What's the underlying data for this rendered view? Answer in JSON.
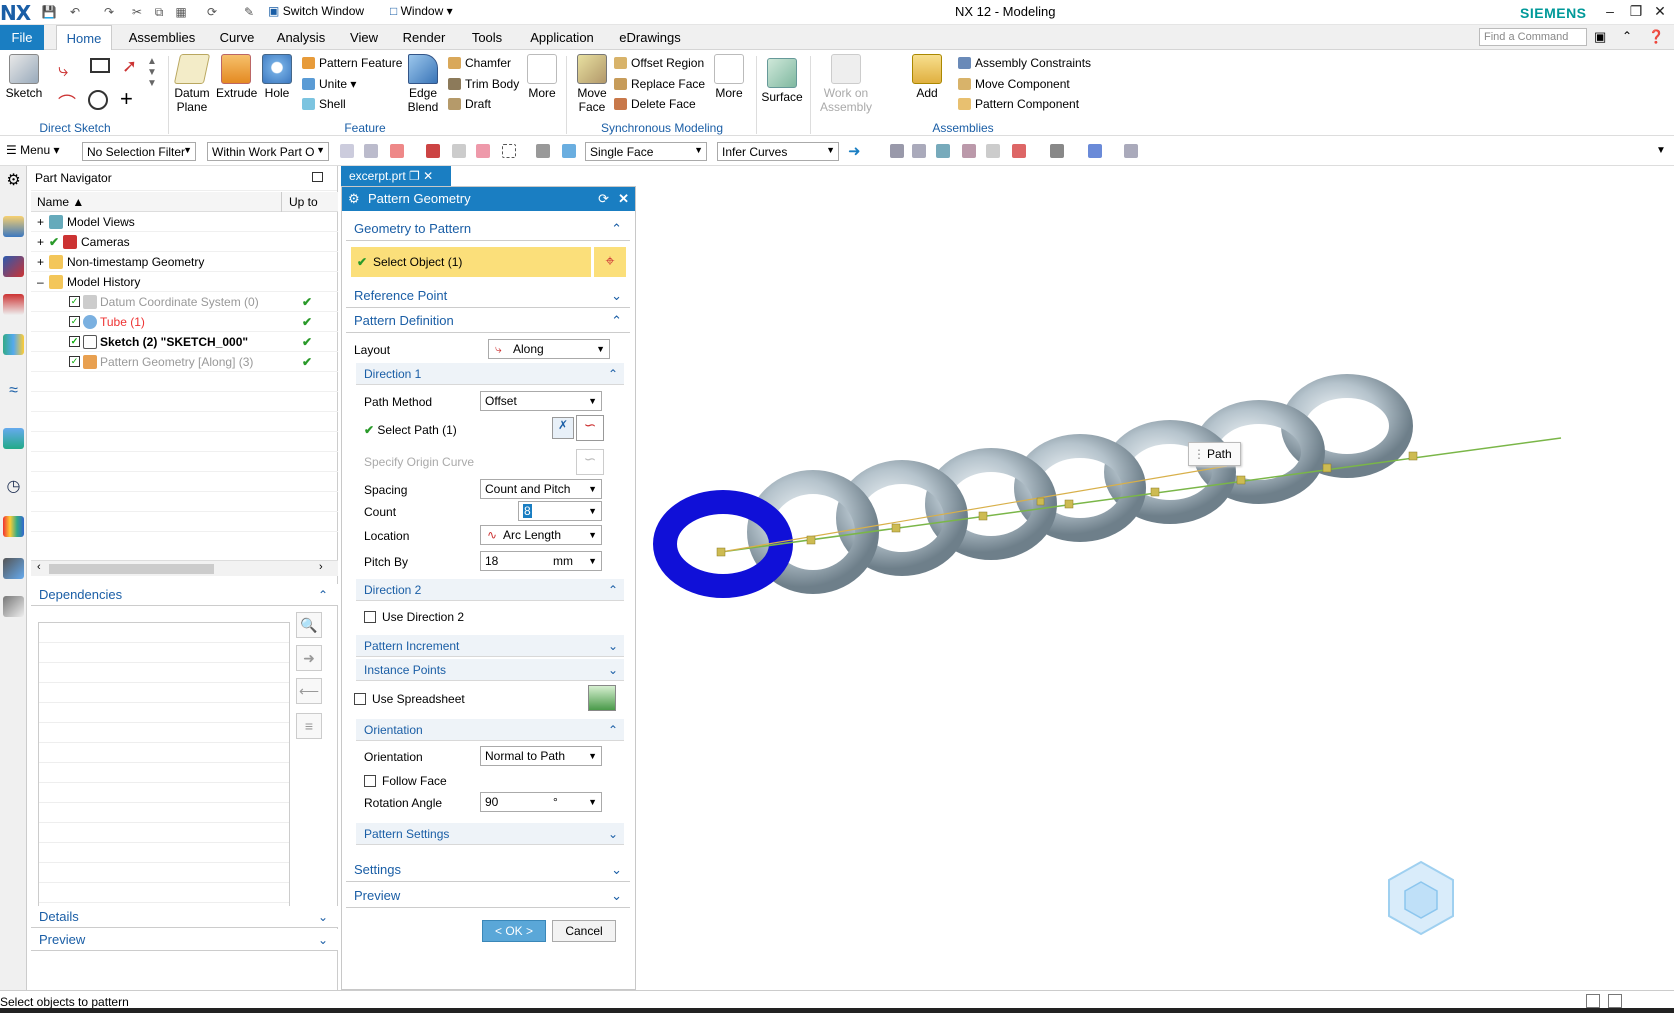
{
  "app": {
    "logo": "NX",
    "title": "NX 12 - Modeling",
    "brand": "SIEMENS",
    "switch_window": "Switch Window",
    "window_menu": "Window"
  },
  "tabs": [
    "File",
    "Home",
    "Assemblies",
    "Curve",
    "Analysis",
    "View",
    "Render",
    "Tools",
    "Application",
    "eDrawings"
  ],
  "find_command": {
    "placeholder": "Find a Command"
  },
  "ribbon": {
    "sketch": "Sketch",
    "datum_plane": "Datum Plane",
    "extrude": "Extrude",
    "hole": "Hole",
    "pattern_feature": "Pattern Feature",
    "unite": "Unite",
    "shell": "Shell",
    "edge_blend": "Edge Blend",
    "chamfer": "Chamfer",
    "trim_body": "Trim Body",
    "draft": "Draft",
    "more1": "More",
    "move_face": "Move Face",
    "offset_region": "Offset Region",
    "replace_face": "Replace Face",
    "delete_face": "Delete Face",
    "more2": "More",
    "surface": "Surface",
    "work_on_assembly": "Work on Assembly",
    "add": "Add",
    "assembly_constraints": "Assembly Constraints",
    "move_component": "Move Component",
    "pattern_component": "Pattern Component",
    "groups": {
      "direct_sketch": "Direct Sketch",
      "feature": "Feature",
      "synchronous": "Synchronous Modeling",
      "assemblies": "Assemblies"
    }
  },
  "toolbar": {
    "menu": "Menu",
    "selection_filter": "No Selection Filter",
    "scope": "Within Work Part O",
    "face_rule": "Single Face",
    "curve_rule": "Infer Curves"
  },
  "part_navigator": {
    "title": "Part Navigator",
    "col_name": "Name",
    "col_up": "Up to",
    "rows": [
      {
        "label": "Model Views"
      },
      {
        "label": "Cameras"
      },
      {
        "label": "Non-timestamp Geometry"
      },
      {
        "label": "Model History"
      },
      {
        "label": "Datum Coordinate System (0)"
      },
      {
        "label": "Tube (1)"
      },
      {
        "label": "Sketch (2) \"SKETCH_000\""
      },
      {
        "label": "Pattern Geometry [Along] (3)"
      }
    ],
    "dependencies": "Dependencies",
    "details": "Details",
    "preview": "Preview"
  },
  "doc_tab": "excerpt.prt",
  "dialog": {
    "title": "Pattern Geometry",
    "geometry_to_pattern": "Geometry to Pattern",
    "select_object": "Select Object (1)",
    "reference_point": "Reference Point",
    "pattern_definition": "Pattern Definition",
    "layout_label": "Layout",
    "layout_value": "Along",
    "direction1": "Direction 1",
    "path_method_label": "Path Method",
    "path_method_value": "Offset",
    "select_path": "Select Path (1)",
    "specify_origin_curve": "Specify Origin Curve",
    "spacing_label": "Spacing",
    "spacing_value": "Count and Pitch",
    "count_label": "Count",
    "count_value": "8",
    "location_label": "Location",
    "location_value": "Arc Length",
    "pitch_label": "Pitch By",
    "pitch_value": "18",
    "pitch_unit": "mm",
    "direction2": "Direction 2",
    "use_direction2": "Use Direction 2",
    "pattern_increment": "Pattern Increment",
    "instance_points": "Instance Points",
    "use_spreadsheet": "Use Spreadsheet",
    "orientation_section": "Orientation",
    "orientation_label": "Orientation",
    "orientation_value": "Normal to Path",
    "follow_face": "Follow Face",
    "rotation_label": "Rotation Angle",
    "rotation_value": "90",
    "rotation_unit": "°",
    "pattern_settings": "Pattern Settings",
    "settings": "Settings",
    "preview": "Preview",
    "ok": "< OK >",
    "cancel": "Cancel"
  },
  "viewport": {
    "path_tag": "Path"
  },
  "status": {
    "message": "Select objects to pattern"
  },
  "colors": {
    "accent": "#1a7ec2",
    "selected_torus": "#1010d8",
    "torus": "#b8c6cf",
    "path_line": "#7ab648",
    "highlight": "#fbdf7a"
  }
}
